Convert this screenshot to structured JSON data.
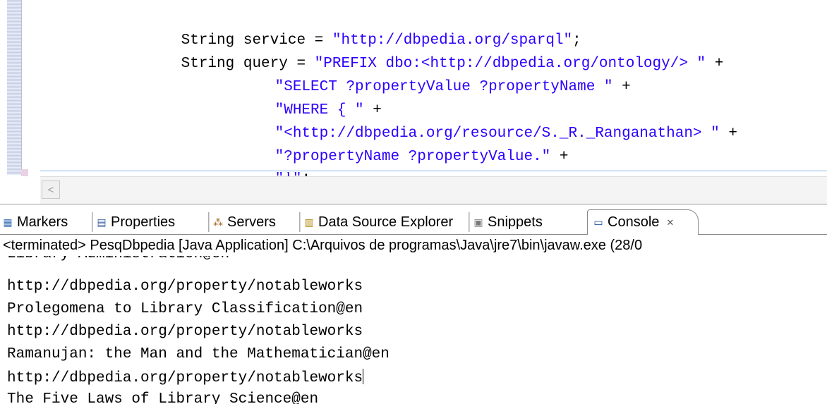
{
  "editor": {
    "lines": [
      {
        "prefix": "String service = ",
        "str": "\"http://dbpedia.org/sparql\"",
        "suffix": ";"
      },
      {
        "prefix": "String query = ",
        "str": "\"PREFIX dbo:<http://dbpedia.org/ontology/> \"",
        "suffix": " +"
      },
      {
        "prefix": "",
        "str": "\"SELECT ?propertyValue ?propertyName \"",
        "suffix": " +"
      },
      {
        "prefix": "",
        "str": "\"WHERE { \"",
        "suffix": " +"
      },
      {
        "prefix": "",
        "str": "\"<http://dbpedia.org/resource/S._R._Ranganathan> \"",
        "suffix": " +"
      },
      {
        "prefix": "",
        "str": "\"?propertyName ?propertyValue.\"",
        "suffix": " +"
      },
      {
        "prefix": "",
        "str": "\"}\"",
        "suffix": ";"
      }
    ],
    "scroll_left_glyph": "<"
  },
  "tabs": [
    {
      "label": "Markers",
      "icon": "markers-icon",
      "glyph": "▦",
      "color": "#3a6fb5"
    },
    {
      "label": "Properties",
      "icon": "properties-icon",
      "glyph": "▤",
      "color": "#3a5fa0"
    },
    {
      "label": "Servers",
      "icon": "servers-icon",
      "glyph": "⁂",
      "color": "#a06a20"
    },
    {
      "label": "Data Source Explorer",
      "icon": "data-source-icon",
      "glyph": "▥",
      "color": "#b08a10"
    },
    {
      "label": "Snippets",
      "icon": "snippets-icon",
      "glyph": "▣",
      "color": "#7a7a7a"
    },
    {
      "label": "Console",
      "icon": "console-icon",
      "glyph": "▭",
      "color": "#2a52a8",
      "close": "✕"
    }
  ],
  "console": {
    "header": "<terminated> PesqDbpedia [Java Application] C:\\Arquivos de programas\\Java\\jre7\\bin\\javaw.exe (28/0",
    "partial_line": "Library Administration@en",
    "lines": [
      "http://dbpedia.org/property/notableworks",
      "Prolegomena to Library Classification@en",
      "http://dbpedia.org/property/notableworks",
      "Ramanujan: the Man and the Mathematician@en",
      "http://dbpedia.org/property/notableworks",
      "The Five Laws of Library Science@en"
    ]
  }
}
